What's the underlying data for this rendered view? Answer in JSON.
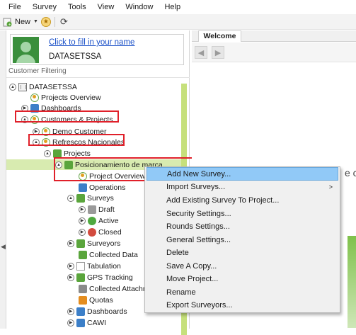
{
  "menubar": {
    "items": [
      "File",
      "Survey",
      "Tools",
      "View",
      "Window",
      "Help"
    ]
  },
  "toolbar": {
    "new_label": "New"
  },
  "user": {
    "link": "Click to fill in your name",
    "name": "DATASETSSA"
  },
  "filter": {
    "label": "Customer Filtering"
  },
  "tree": {
    "nodes": [
      {
        "label": "DATASETSSA"
      },
      {
        "label": "Projects Overview"
      },
      {
        "label": "Dashboards"
      },
      {
        "label": "Customers & Projects"
      },
      {
        "label": "Demo Customer"
      },
      {
        "label": "Refrescos Nacionales"
      },
      {
        "label": "Projects"
      },
      {
        "label": "Posicionamiento de marca"
      },
      {
        "label": "Project Overview"
      },
      {
        "label": "Operations"
      },
      {
        "label": "Surveys"
      },
      {
        "label": "Draft"
      },
      {
        "label": "Active"
      },
      {
        "label": "Closed"
      },
      {
        "label": "Surveyors"
      },
      {
        "label": "Collected Data"
      },
      {
        "label": "Tabulation"
      },
      {
        "label": "GPS Tracking"
      },
      {
        "label": "Collected Attachm"
      },
      {
        "label": "Quotas"
      },
      {
        "label": "Dashboards"
      },
      {
        "label": "CAWI"
      }
    ]
  },
  "welcome": {
    "tab": "Welcome",
    "peek": "e co"
  },
  "context_menu": {
    "items": [
      {
        "label": "Add New Survey..."
      },
      {
        "label": "Import Surveys..."
      },
      {
        "label": "Add Existing Survey To Project..."
      },
      {
        "label": "Security Settings..."
      },
      {
        "label": "Rounds Settings..."
      },
      {
        "label": "General Settings..."
      },
      {
        "label": "Delete"
      },
      {
        "label": "Save A Copy..."
      },
      {
        "label": "Move Project..."
      },
      {
        "label": "Rename"
      },
      {
        "label": "Export Surveyors..."
      }
    ]
  },
  "colors": {
    "accent": "#91c9f7",
    "selection": "#d8ebb0",
    "annotation": "#e0202a",
    "avatar": "#3a8f3c"
  },
  "icons": {
    "new": "survey-new-icon",
    "favorite": "star-icon",
    "refresh": "refresh-icon",
    "back": "arrow-left-icon",
    "forward": "arrow-right-icon",
    "submenu": "chevron-right-icon"
  }
}
